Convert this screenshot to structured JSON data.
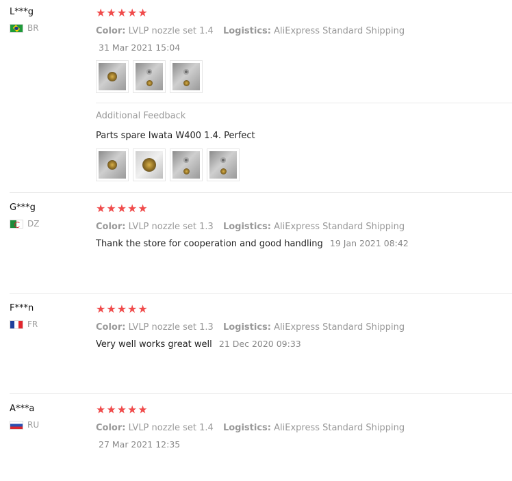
{
  "reviews": [
    {
      "user": "L***g",
      "country": "BR",
      "stars": "★★★★★",
      "color_label": "Color:",
      "color_value": "LVLP nozzle set 1.4",
      "logistics_label": "Logistics:",
      "logistics_value": "AliExpress Standard Shipping",
      "date": "31 Mar 2021 15:04",
      "additional_feedback_title": "Additional Feedback",
      "additional_feedback_text": "Parts spare Iwata W400 1.4. Perfect"
    },
    {
      "user": "G***g",
      "country": "DZ",
      "stars": "★★★★★",
      "color_label": "Color:",
      "color_value": "LVLP nozzle set 1.3",
      "logistics_label": "Logistics:",
      "logistics_value": "AliExpress Standard Shipping",
      "text": "Thank the store for cooperation and good handling",
      "date": "19 Jan 2021 08:42"
    },
    {
      "user": "F***n",
      "country": "FR",
      "stars": "★★★★★",
      "color_label": "Color:",
      "color_value": "LVLP nozzle set 1.3",
      "logistics_label": "Logistics:",
      "logistics_value": "AliExpress Standard Shipping",
      "text": "Very well works great well",
      "date": "21 Dec 2020 09:33"
    },
    {
      "user": "A***a",
      "country": "RU",
      "stars": "★★★★★",
      "color_label": "Color:",
      "color_value": "LVLP nozzle set 1.4",
      "logistics_label": "Logistics:",
      "logistics_value": "AliExpress Standard Shipping",
      "date": "27 Mar 2021 12:35"
    }
  ],
  "colors": {
    "star": "#f04b4b",
    "muted": "#999999",
    "divider": "#e8e8e8"
  }
}
